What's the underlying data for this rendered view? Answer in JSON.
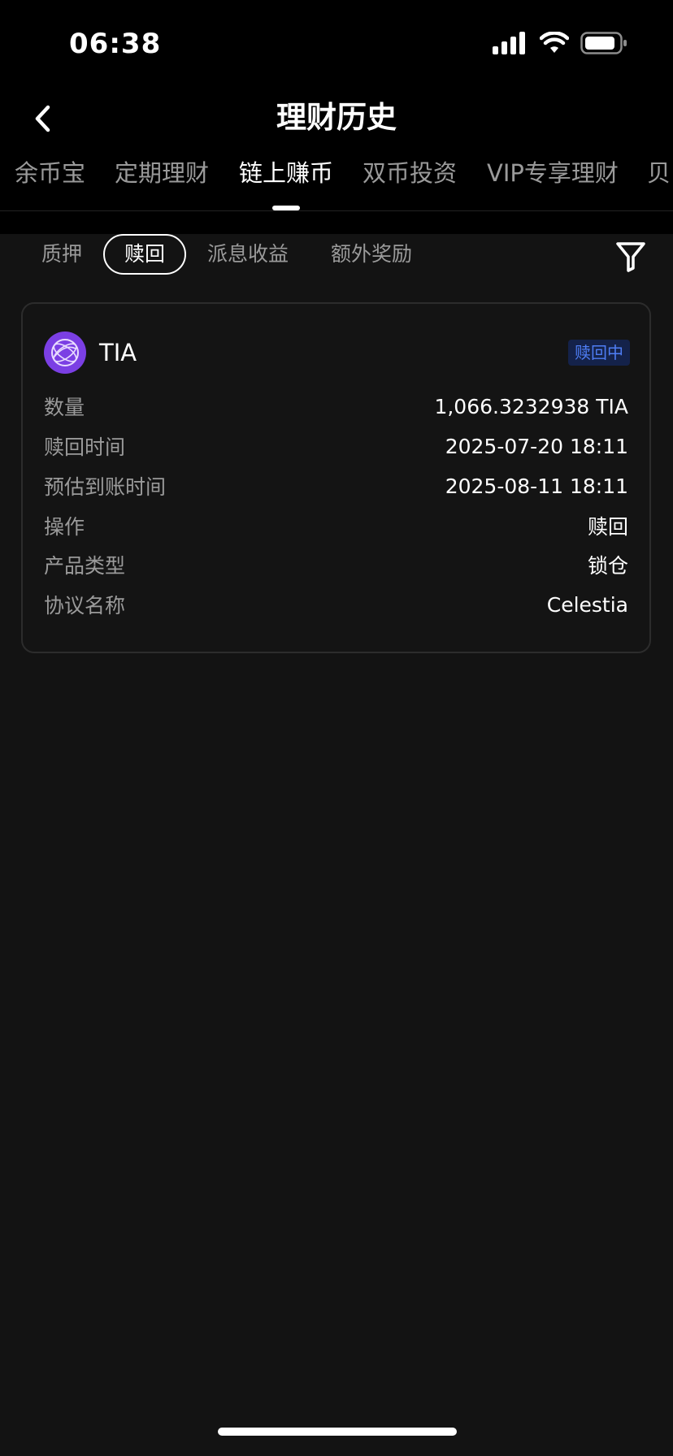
{
  "status_bar": {
    "time": "06:38",
    "icons": [
      "signal-icon",
      "wifi-icon",
      "battery-icon"
    ]
  },
  "header": {
    "title": "理财历史",
    "back_icon": "chevron-left-icon"
  },
  "top_tabs": [
    {
      "label": "余币宝",
      "active": false
    },
    {
      "label": "定期理财",
      "active": false
    },
    {
      "label": "链上赚币",
      "active": true
    },
    {
      "label": "双币投资",
      "active": false
    },
    {
      "label": "VIP专享理财",
      "active": false
    },
    {
      "label": "贝",
      "active": false
    }
  ],
  "sub_tabs": [
    {
      "label": "质押",
      "active": false
    },
    {
      "label": "赎回",
      "active": true
    },
    {
      "label": "派息收益",
      "active": false
    },
    {
      "label": "额外奖励",
      "active": false
    }
  ],
  "filter_icon": "filter-icon",
  "card": {
    "coin": "TIA",
    "coin_icon": "tia-logo-icon",
    "status": "赎回中",
    "rows": [
      {
        "label": "数量",
        "value": "1,066.3232938 TIA"
      },
      {
        "label": "赎回时间",
        "value": "2025-07-20 18:11"
      },
      {
        "label": "预估到账时间",
        "value": "2025-08-11 18:11"
      },
      {
        "label": "操作",
        "value": "赎回"
      },
      {
        "label": "产品类型",
        "value": "锁仓"
      },
      {
        "label": "协议名称",
        "value": "Celestia"
      }
    ]
  },
  "colors": {
    "background": "#131313",
    "header_background": "#000000",
    "muted_text": "#9a9a9a",
    "badge_text": "#4e7df4",
    "badge_background": "#14224a",
    "coin_logo": "#7b3fe4"
  }
}
